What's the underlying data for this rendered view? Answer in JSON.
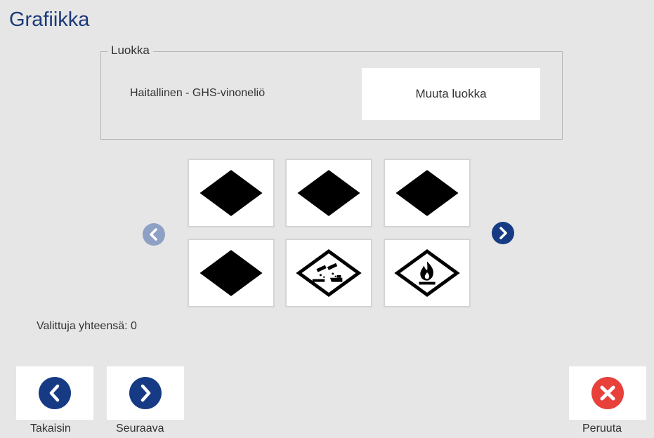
{
  "header": {
    "title": "Grafiikka"
  },
  "category": {
    "legend": "Luokka",
    "value": "Haitallinen - GHS-vinoneliö",
    "change_button_label": "Muuta luokka"
  },
  "graphics_grid": {
    "tiles": [
      {
        "icon": "black-diamond-icon"
      },
      {
        "icon": "black-diamond-icon"
      },
      {
        "icon": "black-diamond-icon"
      },
      {
        "icon": "black-diamond-icon"
      },
      {
        "icon": "ghs-corrosive-icon"
      },
      {
        "icon": "ghs-flame-icon"
      }
    ],
    "prev_icon": "chevron-left-icon",
    "next_icon": "chevron-right-icon"
  },
  "status": {
    "selected_count_text": "Valittuja yhteensä: 0"
  },
  "footer": {
    "back_label": "Takaisin",
    "next_label": "Seuraava",
    "cancel_label": "Peruuta"
  },
  "colors": {
    "accent": "#173a85",
    "title": "#1b3a7a",
    "cancel": "#e8403a",
    "disabled_nav": "#8ea0c4",
    "background": "#e6e6e6"
  }
}
